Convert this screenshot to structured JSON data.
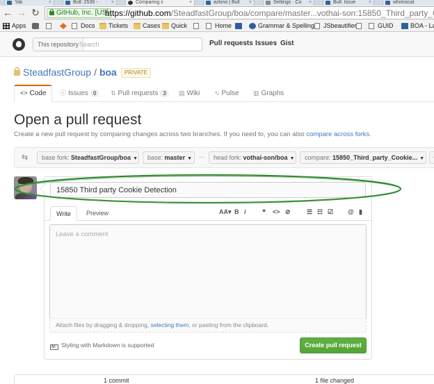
{
  "browser": {
    "tabs": [
      {
        "label": "Yak"
      },
      {
        "label": "Bull: 2539 -"
      },
      {
        "label": "Comparing s"
      },
      {
        "label": "azkino | Bull"
      },
      {
        "label": "Settings · Co"
      },
      {
        "label": "Bull: Issue"
      },
      {
        "label": "whimsical"
      }
    ],
    "secure_badge": "GitHub, Inc. [US]",
    "url_host": "https://github.com",
    "url_path": "/SteadfastGroup/boa/compare/master...vothai-son:15850_Third_party_Cookie_Det",
    "bookmarks": [
      "Apps",
      "Docs",
      "Tickets",
      "Cases",
      "Quick",
      "Home",
      "Grammar & Spelling",
      "JSbeautifier",
      "GUID",
      "BOA - La"
    ]
  },
  "gh_header": {
    "scope_label": "This repository",
    "search_placeholder": "Search",
    "nav": [
      "Pull requests",
      "Issues",
      "Gist"
    ]
  },
  "repo": {
    "owner": "SteadfastGroup",
    "separator": "/",
    "name": "boa",
    "private_label": "PRIVATE",
    "tabs": [
      {
        "icon": "<>",
        "label": "Code",
        "counter": ""
      },
      {
        "icon": "ⓘ",
        "label": "Issues",
        "counter": "0"
      },
      {
        "icon": "⇅",
        "label": "Pull requests",
        "counter": "3"
      },
      {
        "icon": "▤",
        "label": "Wiki",
        "counter": ""
      },
      {
        "icon": "∿",
        "label": "Pulse",
        "counter": ""
      },
      {
        "icon": "▥",
        "label": "Graphs",
        "counter": ""
      }
    ]
  },
  "page": {
    "title": "Open a pull request",
    "subtitle_prefix": "Create a new pull request by comparing changes across two branches. If you need to, you can also ",
    "compare_forks_link": "compare across forks",
    "subtitle_suffix": "."
  },
  "range": {
    "base_fork_label": "base fork:",
    "base_fork_value": "SteadfastGroup/boa",
    "base_label": "base:",
    "base_value": "master",
    "dots": "...",
    "head_fork_label": "head fork:",
    "head_fork_value": "vothai-son/boa",
    "compare_label": "compare:",
    "compare_value": "15850_Third_party_Cookie..."
  },
  "form": {
    "title_value": "15850 Third party Cookie Detection",
    "tab_write": "Write",
    "tab_preview": "Preview",
    "toolbar": {
      "text_size": "AA▾",
      "bold": "B",
      "italic": "i",
      "quote": "❝",
      "code": "<>",
      "link": "⊘",
      "bullet_list": "☰",
      "numbered_list": "☷",
      "task_list": "☑",
      "mention": "@",
      "bookmark": "▮"
    },
    "comment_placeholder": "Leave a comment",
    "attach_prefix": "Attach files by dragging & dropping, ",
    "attach_link": "selecting them",
    "attach_suffix": ", or pasting from the clipboard.",
    "markdown_icon": "M↓",
    "markdown_note": "Styling with Markdown is supported",
    "submit_label": "Create pull request"
  },
  "stats": {
    "commits": "1 commit",
    "files": "1 file changed"
  },
  "colors": {
    "link": "#4078c0",
    "accent_tab": "#d26911",
    "submit_green": "#55a532",
    "annotation_green": "#2f8a2f"
  }
}
